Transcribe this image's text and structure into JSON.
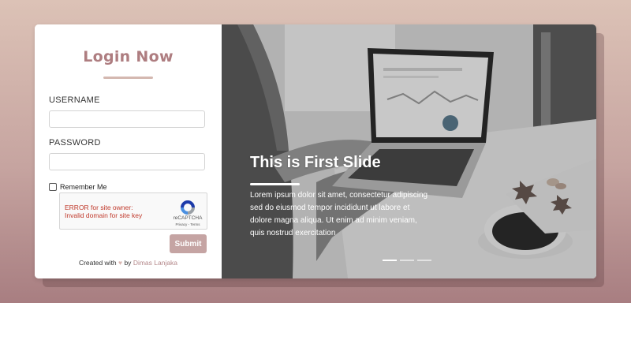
{
  "login": {
    "title": "Login Now",
    "username_label": "USERNAME",
    "username_value": "",
    "password_label": "PASSWORD",
    "password_value": "",
    "remember_label": "Remember Me",
    "remember_checked": false,
    "captcha": {
      "error_line1": "ERROR for site owner:",
      "error_line2": "Invalid domain for site key",
      "brand": "reCAPTCHA",
      "links": "Privacy - Terms"
    },
    "submit_label": "Submit",
    "credit": {
      "prefix": "Created with",
      "heart": "♥",
      "by": "by",
      "author": "Dimas Lanjaka"
    }
  },
  "slider": {
    "title": "This is First Slide",
    "text": "Lorem ipsum dolor sit amet, consectetur adipiscing sed do eiusmod tempor incididunt ut labore et dolore magna aliqua. Ut enim ad minim veniam, quis nostrud exercitation",
    "active_slide": 1,
    "slide_count": 3
  },
  "colors": {
    "accent": "#ae7d80",
    "button": "#c5a4a3",
    "underline": "#d4b8b0"
  }
}
